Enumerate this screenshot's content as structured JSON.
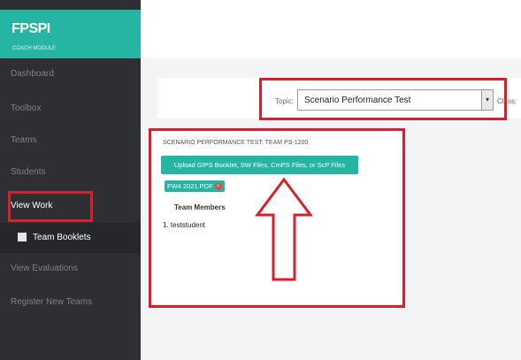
{
  "brand": {
    "title": "FPSPI",
    "subtitle": "COACH MODULE",
    "color": "#26b4a3"
  },
  "sidebar": {
    "items": [
      {
        "label": "Dashboard"
      },
      {
        "label": "Toolbox"
      },
      {
        "label": "Teams"
      },
      {
        "label": "Students"
      },
      {
        "label": "View Work",
        "active": true
      },
      {
        "label": "Team Booklets",
        "submenu": true
      },
      {
        "label": "View Evaluations"
      },
      {
        "label": "Register New Teams"
      }
    ]
  },
  "topic": {
    "label": "Topic:",
    "selected": "Scenario Performance Test",
    "class_label": "Class:"
  },
  "work": {
    "title": "SCENARIO PERFORMANCE TEST: TEAM PS-1200",
    "upload_label": "Upload GIPS Booklet, SW Files, CmPS Files, or ScP Files",
    "file_name": "FW4 2021.PDF",
    "remove_icon": "×",
    "members_heading": "Team Members",
    "members": [
      "1. teststudent"
    ]
  },
  "annotations": {
    "highlight_color": "#d81f2b"
  }
}
